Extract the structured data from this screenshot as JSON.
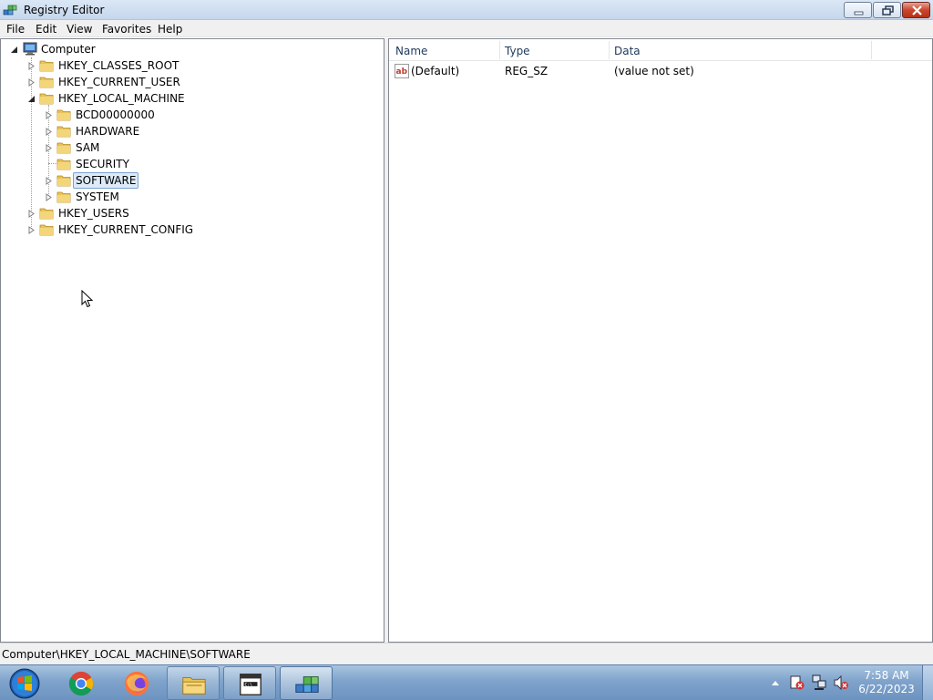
{
  "window": {
    "title": "Registry Editor",
    "icon": "regedit-icon"
  },
  "menu": [
    "File",
    "Edit",
    "View",
    "Favorites",
    "Help"
  ],
  "tree": {
    "root": "Computer",
    "hives": [
      {
        "label": "HKEY_CLASSES_ROOT",
        "expanded": false
      },
      {
        "label": "HKEY_CURRENT_USER",
        "expanded": false
      },
      {
        "label": "HKEY_LOCAL_MACHINE",
        "expanded": true,
        "children": [
          {
            "label": "BCD00000000",
            "has_children": true
          },
          {
            "label": "HARDWARE",
            "has_children": true
          },
          {
            "label": "SAM",
            "has_children": true
          },
          {
            "label": "SECURITY",
            "has_children": false
          },
          {
            "label": "SOFTWARE",
            "has_children": true,
            "selected": true
          },
          {
            "label": "SYSTEM",
            "has_children": true
          }
        ]
      },
      {
        "label": "HKEY_USERS",
        "expanded": false
      },
      {
        "label": "HKEY_CURRENT_CONFIG",
        "expanded": false
      }
    ]
  },
  "list": {
    "columns": [
      "Name",
      "Type",
      "Data"
    ],
    "rows": [
      {
        "name": "(Default)",
        "type": "REG_SZ",
        "data": "(value not set)",
        "icon": "string-value-icon"
      }
    ]
  },
  "status": {
    "path": "Computer\\HKEY_LOCAL_MACHINE\\SOFTWARE"
  },
  "taskbar": {
    "apps": [
      "start-orb",
      "chrome-icon",
      "firefox-icon",
      "file-explorer-icon",
      "cmd-window-icon",
      "regedit-icon"
    ],
    "time": "7:58 AM",
    "date": "6/22/2023"
  },
  "colors": {
    "selection": "#dceaf9",
    "selection_border": "#7da2ce",
    "folder": "#e8c35a",
    "taskbar": "#7fa3cb"
  }
}
